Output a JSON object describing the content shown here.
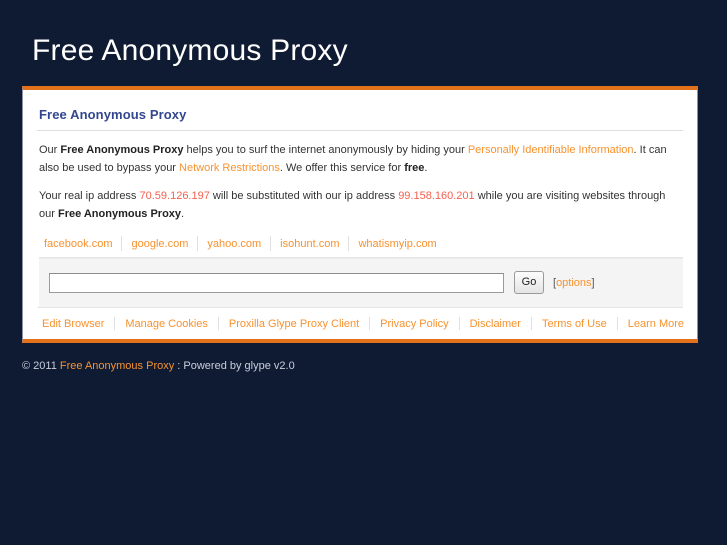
{
  "site": {
    "title": "Free Anonymous Proxy"
  },
  "panel": {
    "heading": "Free Anonymous Proxy",
    "paragraph1": {
      "seg1": "Our ",
      "brand1": "Free Anonymous Proxy",
      "seg2": " helps you to surf the internet anonymously by hiding your ",
      "link1": "Personally Identifiable Information",
      "seg3": ". It can also be used to bypass your ",
      "link2": "Network Restrictions",
      "seg4": ". We offer this service for ",
      "bold1": "free",
      "seg5": "."
    },
    "paragraph2": {
      "seg1": "Your real ip address ",
      "real_ip": "70.59.126.197",
      "seg2": " will be substituted with our ip address ",
      "proxy_ip": "99.158.160.201",
      "seg3": " while you are visiting websites through our ",
      "brand": "Free Anonymous Proxy",
      "seg4": "."
    },
    "quicklinks": [
      {
        "label": "facebook.com"
      },
      {
        "label": "google.com"
      },
      {
        "label": "yahoo.com"
      },
      {
        "label": "isohunt.com"
      },
      {
        "label": "whatismyip.com"
      }
    ],
    "search": {
      "url_value": "",
      "url_placeholder": "",
      "go_label": "Go",
      "options_open_bracket": "[",
      "options_label": "options",
      "options_close_bracket": "]"
    },
    "nav_left": [
      {
        "label": "Edit Browser"
      },
      {
        "label": "Manage Cookies"
      }
    ],
    "nav_right": [
      {
        "label": "Proxilla Glype Proxy Client"
      },
      {
        "label": "Privacy Policy"
      },
      {
        "label": "Disclaimer"
      },
      {
        "label": "Terms of Use"
      },
      {
        "label": "Learn More"
      }
    ]
  },
  "footer": {
    "copyright": "© 2011",
    "brand_link": "Free Anonymous Proxy",
    "suffix": ": Powered by glype v2.0"
  },
  "colors": {
    "background": "#0f1b33",
    "accent_orange": "#e3701a",
    "link_orange": "#f7922e",
    "heading_blue": "#33478f",
    "ip_red": "#f4604f"
  }
}
